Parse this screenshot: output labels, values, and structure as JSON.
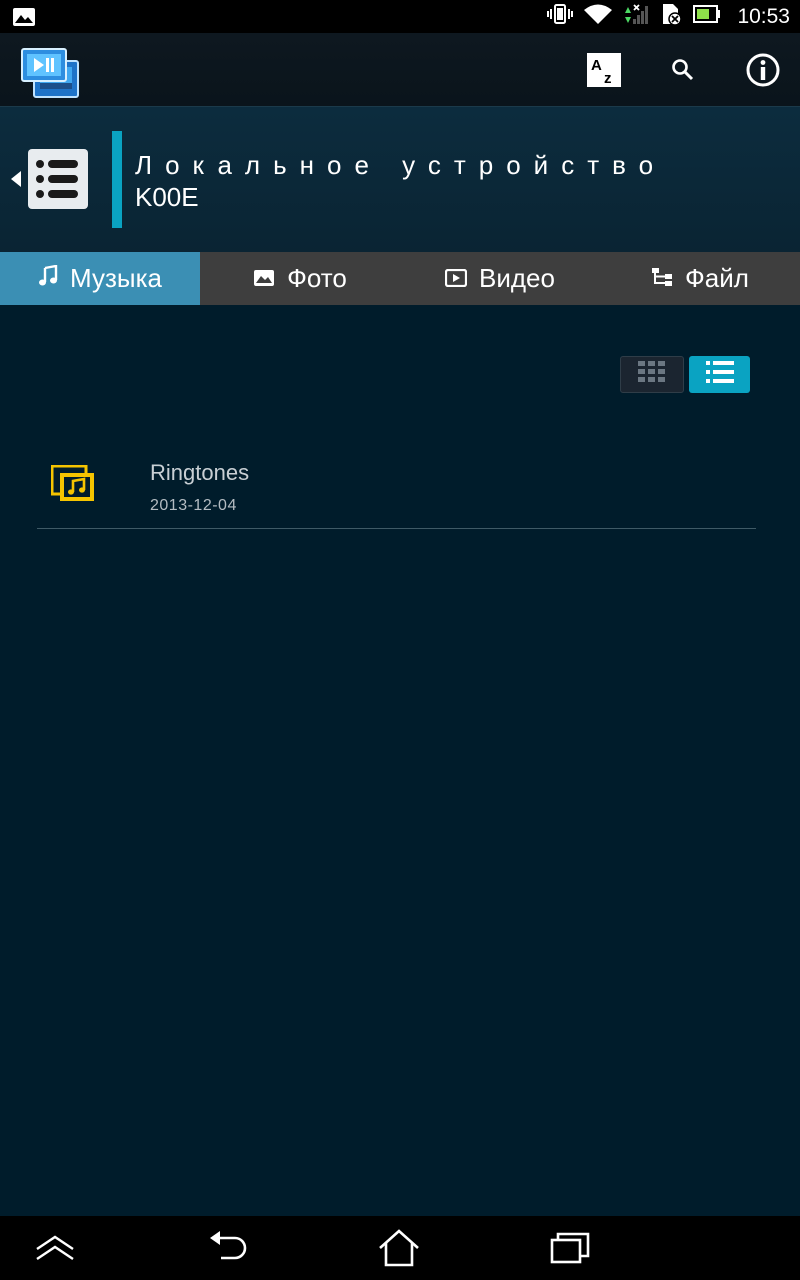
{
  "status_bar": {
    "time": "10:53",
    "icons": [
      "image-notification-icon",
      "vibrate-icon",
      "wifi-icon",
      "signal-icon",
      "sd-card-icon",
      "battery-icon"
    ],
    "battery_color": "#8ee04a"
  },
  "action_bar": {
    "icons": [
      "app-logo",
      "sort-az-icon",
      "search-icon",
      "info-icon"
    ],
    "sort_label_a": "A",
    "sort_label_z": "z"
  },
  "device": {
    "title": "Локальное устройство",
    "subtitle": "K00E",
    "accent_color": "#0aa3c2"
  },
  "tabs": [
    {
      "label": "Музыка",
      "icon": "music-note-icon",
      "active": true
    },
    {
      "label": "Фото",
      "icon": "photo-icon",
      "active": false
    },
    {
      "label": "Видео",
      "icon": "video-icon",
      "active": false
    },
    {
      "label": "Файл",
      "icon": "file-tree-icon",
      "active": false
    }
  ],
  "view_toggle": {
    "grid": "grid-view-icon",
    "list": "list-view-icon",
    "selected": "list"
  },
  "items": [
    {
      "name": "Ringtones",
      "date": "2013-12-04",
      "icon": "music-folder-icon"
    }
  ],
  "nav_bar": {
    "icons": [
      "hide-nav-icon",
      "back-icon",
      "home-icon",
      "recent-apps-icon"
    ]
  }
}
